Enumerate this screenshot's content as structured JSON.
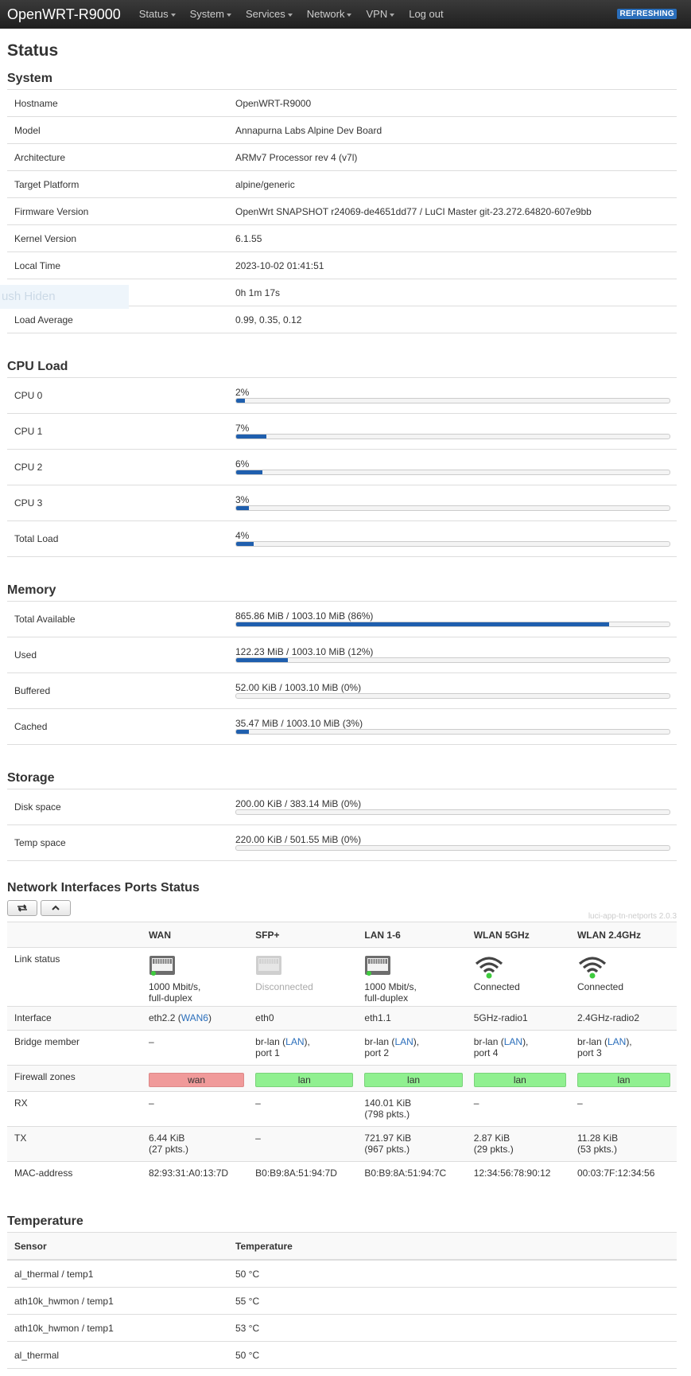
{
  "navbar": {
    "brand": "OpenWRT-R9000",
    "menu": [
      "Status",
      "System",
      "Services",
      "Network",
      "VPN"
    ],
    "logout": "Log out",
    "refreshing": "REFRESHING"
  },
  "page_title": "Status",
  "ghost_text": "ush Hiden",
  "system": {
    "title": "System",
    "rows": [
      {
        "key": "Hostname",
        "value": "OpenWRT-R9000"
      },
      {
        "key": "Model",
        "value": "Annapurna Labs Alpine Dev Board"
      },
      {
        "key": "Architecture",
        "value": "ARMv7 Processor rev 4 (v7l)"
      },
      {
        "key": "Target Platform",
        "value": "alpine/generic"
      },
      {
        "key": "Firmware Version",
        "value": "OpenWrt SNAPSHOT r24069-de4651dd77 / LuCI Master git-23.272.64820-607e9bb"
      },
      {
        "key": "Kernel Version",
        "value": "6.1.55"
      },
      {
        "key": "Local Time",
        "value": "2023-10-02 01:41:51"
      },
      {
        "key": "Uptime",
        "value": "0h 1m 17s"
      },
      {
        "key": "Load Average",
        "value": "0.99, 0.35, 0.12"
      }
    ]
  },
  "cpu": {
    "title": "CPU Load",
    "rows": [
      {
        "key": "CPU 0",
        "label": "2%",
        "fraction": 0.02
      },
      {
        "key": "CPU 1",
        "label": "7%",
        "fraction": 0.07
      },
      {
        "key": "CPU 2",
        "label": "6%",
        "fraction": 0.06
      },
      {
        "key": "CPU 3",
        "label": "3%",
        "fraction": 0.03
      },
      {
        "key": "Total Load",
        "label": "4%",
        "fraction": 0.04
      }
    ]
  },
  "memory": {
    "title": "Memory",
    "rows": [
      {
        "key": "Total Available",
        "label": "865.86 MiB / 1003.10 MiB (86%)",
        "fraction": 0.86
      },
      {
        "key": "Used",
        "label": "122.23 MiB / 1003.10 MiB (12%)",
        "fraction": 0.12
      },
      {
        "key": "Buffered",
        "label": "52.00 KiB / 1003.10 MiB (0%)",
        "fraction": 0.0
      },
      {
        "key": "Cached",
        "label": "35.47 MiB / 1003.10 MiB (3%)",
        "fraction": 0.03
      }
    ]
  },
  "storage": {
    "title": "Storage",
    "rows": [
      {
        "key": "Disk space",
        "label": "200.00 KiB / 383.14 MiB (0%)",
        "fraction": 0.0
      },
      {
        "key": "Temp space",
        "label": "220.00 KiB / 501.55 MiB (0%)",
        "fraction": 0.0
      }
    ]
  },
  "ports": {
    "title": "Network Interfaces Ports Status",
    "version": "luci-app-tn-netports 2.0.3",
    "columns": [
      "WAN",
      "SFP+",
      "LAN 1-6",
      "WLAN 5GHz",
      "WLAN 2.4GHz"
    ],
    "row_labels": {
      "link": "Link status",
      "iface": "Interface",
      "bridge": "Bridge member",
      "fw": "Firewall zones",
      "rx": "RX",
      "tx": "TX",
      "mac": "MAC-address"
    },
    "link": [
      {
        "icon": "ethernet-port-connected-icon",
        "line1": "1000 Mbit/s,",
        "line2": "full-duplex"
      },
      {
        "icon": "ethernet-port-disconnected-icon",
        "line1": "Disconnected",
        "line2": ""
      },
      {
        "icon": "ethernet-port-connected-icon",
        "line1": "1000 Mbit/s,",
        "line2": "full-duplex"
      },
      {
        "icon": "wifi-connected-icon",
        "line1": "Connected",
        "line2": ""
      },
      {
        "icon": "wifi-connected-icon",
        "line1": "Connected",
        "line2": ""
      }
    ],
    "iface": [
      {
        "name": "eth2.2 (",
        "link": "WAN6",
        "tail": ")"
      },
      {
        "name": "eth0",
        "link": "",
        "tail": ""
      },
      {
        "name": "eth1.1",
        "link": "",
        "tail": ""
      },
      {
        "name": "5GHz-radio1",
        "link": "",
        "tail": ""
      },
      {
        "name": "2.4GHz-radio2",
        "link": "",
        "tail": ""
      }
    ],
    "bridge": [
      {
        "pre": "–",
        "link": "",
        "post": "",
        "line2": ""
      },
      {
        "pre": "br-lan (",
        "link": "LAN",
        "post": "),",
        "line2": "port 1"
      },
      {
        "pre": "br-lan (",
        "link": "LAN",
        "post": "),",
        "line2": "port 2"
      },
      {
        "pre": "br-lan (",
        "link": "LAN",
        "post": "),",
        "line2": "port 4"
      },
      {
        "pre": "br-lan (",
        "link": "LAN",
        "post": "),",
        "line2": "port 3"
      }
    ],
    "fw": [
      "wan",
      "lan",
      "lan",
      "lan",
      "lan"
    ],
    "rx": [
      {
        "line1": "–",
        "line2": ""
      },
      {
        "line1": "–",
        "line2": ""
      },
      {
        "line1": "140.01 KiB",
        "line2": "(798 pkts.)"
      },
      {
        "line1": "–",
        "line2": ""
      },
      {
        "line1": "–",
        "line2": ""
      }
    ],
    "tx": [
      {
        "line1": "6.44 KiB",
        "line2": "(27 pkts.)"
      },
      {
        "line1": "–",
        "line2": ""
      },
      {
        "line1": "721.97 KiB",
        "line2": "(967 pkts.)"
      },
      {
        "line1": "2.87 KiB",
        "line2": "(29 pkts.)"
      },
      {
        "line1": "11.28 KiB",
        "line2": "(53 pkts.)"
      }
    ],
    "mac": [
      "82:93:31:A0:13:7D",
      "B0:B9:8A:51:94:7D",
      "B0:B9:8A:51:94:7C",
      "12:34:56:78:90:12",
      "00:03:7F:12:34:56"
    ]
  },
  "temperature": {
    "title": "Temperature",
    "headers": [
      "Sensor",
      "Temperature"
    ],
    "rows": [
      {
        "sensor": "al_thermal / temp1",
        "value": "50 °C"
      },
      {
        "sensor": "ath10k_hwmon / temp1",
        "value": "55 °C"
      },
      {
        "sensor": "ath10k_hwmon / temp1",
        "value": "53 °C"
      },
      {
        "sensor": "al_thermal",
        "value": "50 °C"
      }
    ]
  }
}
